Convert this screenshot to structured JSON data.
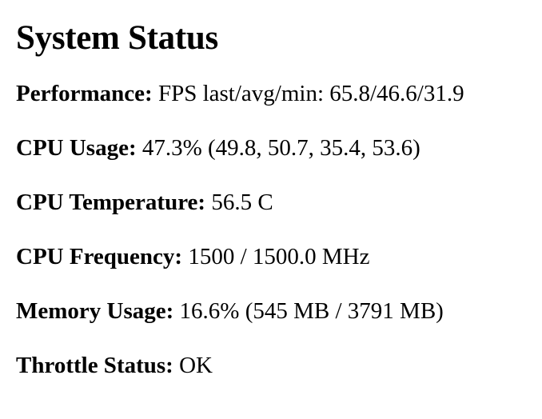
{
  "page_title": "System Status",
  "stats": [
    {
      "label": "Performance:",
      "value": "FPS last/avg/min: 65.8/46.6/31.9"
    },
    {
      "label": "CPU Usage:",
      "value": "47.3% (49.8, 50.7, 35.4, 53.6)"
    },
    {
      "label": "CPU Temperature:",
      "value": "56.5 C"
    },
    {
      "label": "CPU Frequency:",
      "value": "1500 / 1500.0 MHz"
    },
    {
      "label": "Memory Usage:",
      "value": "16.6% (545 MB / 3791 MB)"
    },
    {
      "label": "Throttle Status:",
      "value": "OK"
    }
  ]
}
